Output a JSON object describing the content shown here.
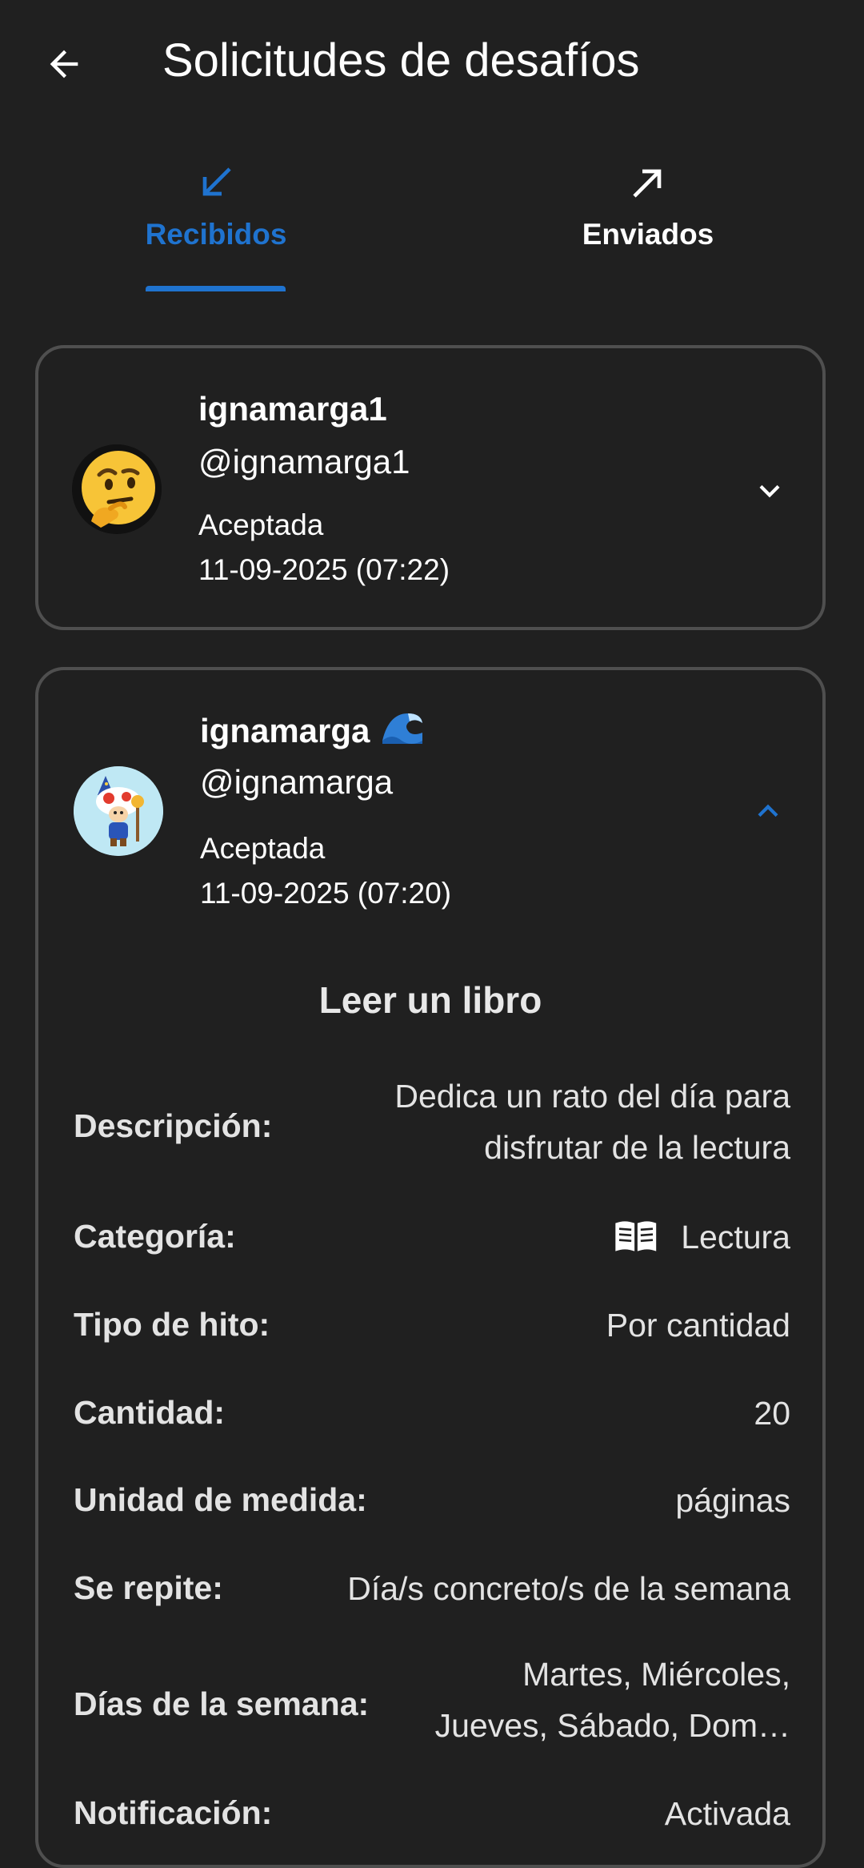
{
  "appbar": {
    "title": "Solicitudes de desafíos",
    "back_icon": "arrow-back-icon"
  },
  "tabs": [
    {
      "label": "Recibidos",
      "icon": "arrow-down-left-icon",
      "selected": true,
      "color": "#1f73cf"
    },
    {
      "label": "Enviados",
      "icon": "arrow-up-right-icon",
      "selected": false,
      "color": "#ffffff"
    }
  ],
  "requests": [
    {
      "name": "ignamarga1",
      "handle": "@ignamarga1",
      "status": "Aceptada",
      "date": "11-09-2025 (07:22)",
      "avatar": "thinking-face-emoji",
      "expanded": false
    },
    {
      "name": "ignamarga",
      "name_emoji": "water-wave-emoji",
      "handle": "@ignamarga",
      "status": "Aceptada",
      "date": "11-09-2025 (07:20)",
      "avatar": "toad-wizard-avatar",
      "expanded": true,
      "challenge": {
        "title": "Leer un libro",
        "rows": [
          {
            "label": "Descripción:",
            "value_line1": "Dedica un rato del día para",
            "value_line2": "disfrutar de la lectura"
          },
          {
            "label": "Categoría:",
            "value": "Lectura",
            "icon": "book-icon"
          },
          {
            "label": "Tipo de hito:",
            "value": "Por cantidad"
          },
          {
            "label": "Cantidad:",
            "value": "20"
          },
          {
            "label": "Unidad de medida:",
            "value": "páginas"
          },
          {
            "label": "Se repite:",
            "value": "Día/s concreto/s de la semana"
          },
          {
            "label": "Días de la semana:",
            "value_line1": "Martes, Miércoles,",
            "value_line2": "Jueves, Sábado, Dom…"
          },
          {
            "label": "Notificación:",
            "value": "Activada"
          }
        ]
      }
    }
  ],
  "colors": {
    "background": "#202020",
    "accent": "#1f73cf",
    "card_border": "#4f4f4f"
  }
}
